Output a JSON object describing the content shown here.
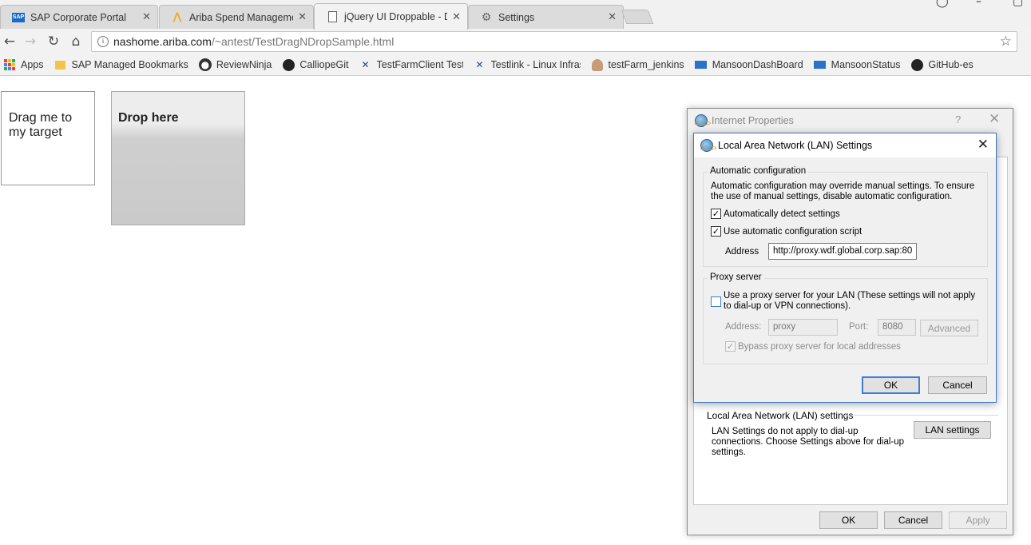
{
  "browser": {
    "tabs": [
      {
        "title": "SAP Corporate Portal",
        "icon": "sap-logo-icon"
      },
      {
        "title": "Ariba Spend Manageme",
        "icon": "ariba-logo-icon"
      },
      {
        "title": "jQuery UI Droppable - D",
        "icon": "page-icon"
      },
      {
        "title": "Settings",
        "icon": "gear-icon"
      }
    ],
    "url_host": "nashome.ariba.com",
    "url_path": "/~antest/TestDragNDropSample.html",
    "bookmarks": [
      {
        "label": "Apps",
        "icon": "apps-grid-icon"
      },
      {
        "label": "SAP Managed Bookmarks",
        "icon": "folder-icon"
      },
      {
        "label": "ReviewNinja",
        "icon": "reviewninja-icon"
      },
      {
        "label": "CalliopeGit",
        "icon": "github-icon"
      },
      {
        "label": "TestFarmClient Test Fr",
        "icon": "testfarm-icon"
      },
      {
        "label": "Testlink - Linux Infras",
        "icon": "testlink-icon"
      },
      {
        "label": "testFarm_jenkins",
        "icon": "jenkins-icon"
      },
      {
        "label": "MansoonDashBoard",
        "icon": "sap-logo-icon"
      },
      {
        "label": "MansoonStatus",
        "icon": "sap-logo-icon"
      },
      {
        "label": "GitHub-es",
        "icon": "github-icon"
      }
    ]
  },
  "page": {
    "draggable_text": "Drag me to my target",
    "droppable_text": "Drop here"
  },
  "internet_properties": {
    "title": "Internet Properties",
    "help_glyph": "?",
    "lan_group_label": "Local Area Network (LAN) settings",
    "lan_note": "LAN Settings do not apply to dial-up connections. Choose Settings above for dial-up settings.",
    "lan_settings_button": "LAN settings",
    "ok": "OK",
    "cancel": "Cancel",
    "apply": "Apply"
  },
  "lan_dialog": {
    "title": "Local Area Network (LAN) Settings",
    "auto_group_label": "Automatic configuration",
    "auto_note": "Automatic configuration may override manual settings.  To ensure the use of manual settings, disable automatic configuration.",
    "auto_detect_label": "Automatically detect settings",
    "auto_detect_checked": true,
    "use_script_label": "Use automatic configuration script",
    "use_script_checked": true,
    "script_address_label": "Address",
    "script_address_value": "http://proxy.wdf.global.corp.sap:80",
    "proxy_group_label": "Proxy server",
    "use_proxy_label": "Use a proxy server for your LAN (These settings will not apply to dial-up or VPN connections).",
    "use_proxy_checked": false,
    "proxy_address_label": "Address:",
    "proxy_address_value": "proxy",
    "proxy_port_label": "Port:",
    "proxy_port_value": "8080",
    "advanced_button": "Advanced",
    "bypass_label": "Bypass proxy server for local addresses",
    "bypass_checked": true,
    "ok": "OK",
    "cancel": "Cancel"
  },
  "colors": {
    "dialog_bg": "#f0f0f0",
    "focus_blue": "#3c7fd5",
    "droppable_gray": "#cacaca"
  }
}
